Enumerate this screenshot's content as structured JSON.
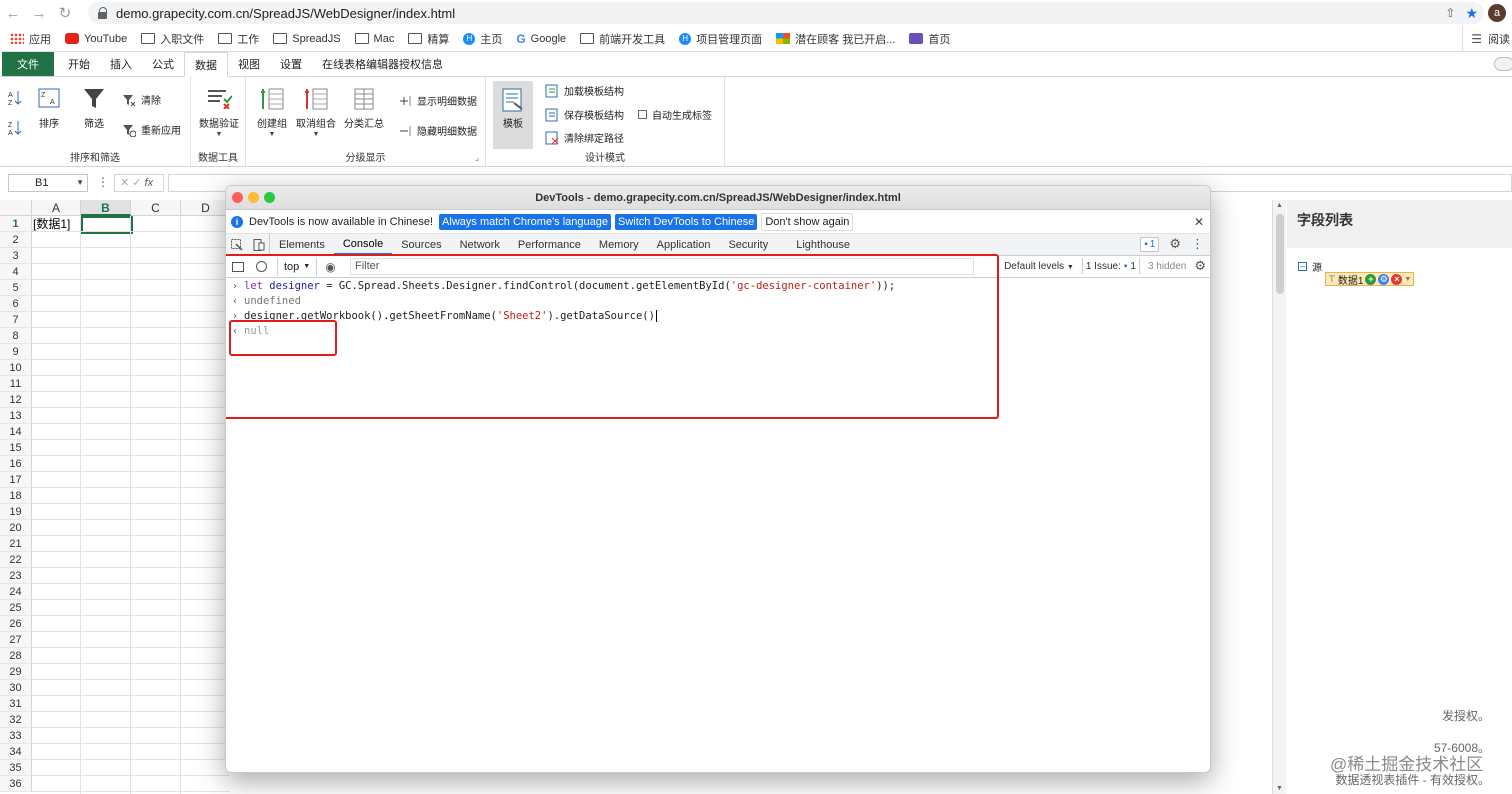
{
  "browser": {
    "url": "demo.grapecity.com.cn/SpreadJS/WebDesigner/index.html",
    "avatar_letter": "a",
    "bookmarks": [
      "应用",
      "YouTube",
      "入职文件",
      "工作",
      "SpreadJS",
      "Mac",
      "精算",
      "主页",
      "Google",
      "前端开发工具",
      "项目管理页面",
      "潜在顾客 我已开启...",
      "首页"
    ],
    "reading_list": "阅读"
  },
  "ribbon": {
    "file_tab": "文件",
    "tabs": [
      "开始",
      "插入",
      "公式",
      "数据",
      "视图",
      "设置",
      "在线表格编辑器授权信息"
    ],
    "active_tab": "数据",
    "sort": "排序",
    "filter": "筛选",
    "clear": "清除",
    "reapply": "重新应用",
    "group_sort_filter": "排序和筛选",
    "data_validation": "数据验证",
    "group_data_tools": "数据工具",
    "create_group": "创建组",
    "ungroup": "取消组合",
    "subtotal": "分类汇总",
    "show_detail": "显示明细数据",
    "hide_detail": "隐藏明细数据",
    "group_outline": "分级显示",
    "template": "模板",
    "load_template": "加载模板结构",
    "save_template": "保存模板结构",
    "clear_binding": "清除绑定路径",
    "auto_label": "自动生成标签",
    "group_design": "设计模式"
  },
  "formula_bar": {
    "name_box": "B1",
    "fx": "fx"
  },
  "sheet": {
    "columns": [
      "A",
      "B",
      "C",
      "D"
    ],
    "rows": [
      "1",
      "2",
      "3",
      "4",
      "5",
      "6",
      "7",
      "8",
      "9",
      "10",
      "11",
      "12",
      "13",
      "14",
      "15",
      "16",
      "17",
      "18",
      "19",
      "20",
      "21",
      "22",
      "23",
      "24",
      "25",
      "26",
      "27",
      "28",
      "29",
      "30",
      "31",
      "32",
      "33",
      "34",
      "35",
      "36"
    ],
    "a1_value": "[数据1]",
    "selected_cell": "B1"
  },
  "field_panel": {
    "title": "字段列表",
    "root": "源",
    "node": "数据1"
  },
  "background_text": {
    "line1": "发授权。",
    "line2": "57-6008。",
    "line3": "数据透视表插件 - 有效授权。"
  },
  "watermark": "@稀土掘金技术社区",
  "devtools": {
    "title": "DevTools - demo.grapecity.com.cn/SpreadJS/WebDesigner/index.html",
    "info_text": "DevTools is now available in Chinese!",
    "btn_match": "Always match Chrome's language",
    "btn_switch": "Switch DevTools to Chinese",
    "btn_dont_show": "Don't show again",
    "tabs": [
      "Elements",
      "Console",
      "Sources",
      "Network",
      "Performance",
      "Memory",
      "Application",
      "Security",
      "Lighthouse"
    ],
    "active_tab": "Console",
    "messages_count": "1",
    "context": "top",
    "filter_placeholder": "Filter",
    "default_levels": "Default levels",
    "issues": "1 Issue:",
    "issues_count": "1",
    "hidden": "3 hidden",
    "console": {
      "line1_kw": "let",
      "line1_var": "designer",
      "line1_mid": " = GC.Spread.Sheets.Designer.findControl(document.getElementById(",
      "line1_str": "'gc-designer-container'",
      "line1_end": "));",
      "line2": "undefined",
      "line3_pre": "designer.getWorkbook().getSheetFromName(",
      "line3_str": "'Sheet2'",
      "line3_end": ").getDataSource()",
      "line4": "null"
    },
    "highlight_color": "#e21b1b"
  }
}
